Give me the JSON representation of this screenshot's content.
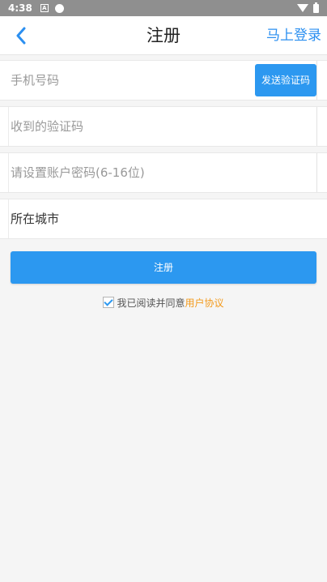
{
  "status_bar": {
    "time": "4:38",
    "icons": [
      "a-notification-icon",
      "circle-icon",
      "wifi-icon",
      "battery-icon"
    ]
  },
  "header": {
    "title": "注册",
    "back_icon": "chevron-left-icon",
    "login_link": "马上登录"
  },
  "form": {
    "phone_placeholder": "手机号码",
    "send_code_label": "发送验证码",
    "code_placeholder": "收到的验证码",
    "password_placeholder": "请设置账户密码(6-16位)",
    "city_label": "所在城市"
  },
  "actions": {
    "submit_label": "注册"
  },
  "agreement": {
    "checked": true,
    "text": "我已阅读并同意",
    "link": "用户协议"
  },
  "colors": {
    "primary": "#2c98f0",
    "link_orange": "#f39a1c",
    "status_bar": "#8f8f8f",
    "background": "#f5f5f5"
  }
}
